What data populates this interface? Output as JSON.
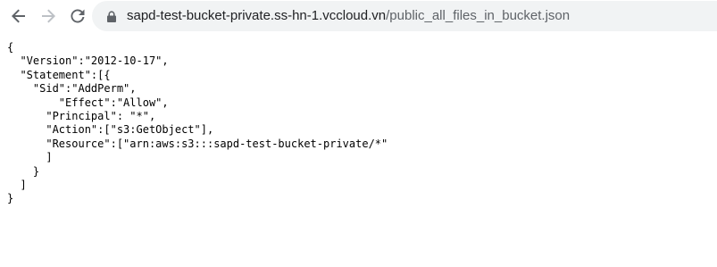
{
  "toolbar": {
    "back_icon": "arrow-back-icon",
    "forward_icon": "arrow-forward-icon",
    "reload_icon": "reload-icon",
    "lock_icon": "lock-icon"
  },
  "address_bar": {
    "host": "sapd-test-bucket-private.ss-hn-1.vccloud.vn",
    "path": "/public_all_files_in_bucket.json"
  },
  "document": {
    "json_text": "{\n  \"Version\":\"2012-10-17\",\n  \"Statement\":[{\n    \"Sid\":\"AddPerm\",\n        \"Effect\":\"Allow\",\n      \"Principal\": \"*\",\n      \"Action\":[\"s3:GetObject\"],\n      \"Resource\":[\"arn:aws:s3:::sapd-test-bucket-private/*\"\n      ]\n    }\n  ]\n}"
  },
  "colors": {
    "omnibox_bg": "#f1f3f4",
    "icon_active": "#5f6368",
    "icon_disabled": "#bdc1c6",
    "host_text": "#202124",
    "path_text": "#5f6368"
  }
}
